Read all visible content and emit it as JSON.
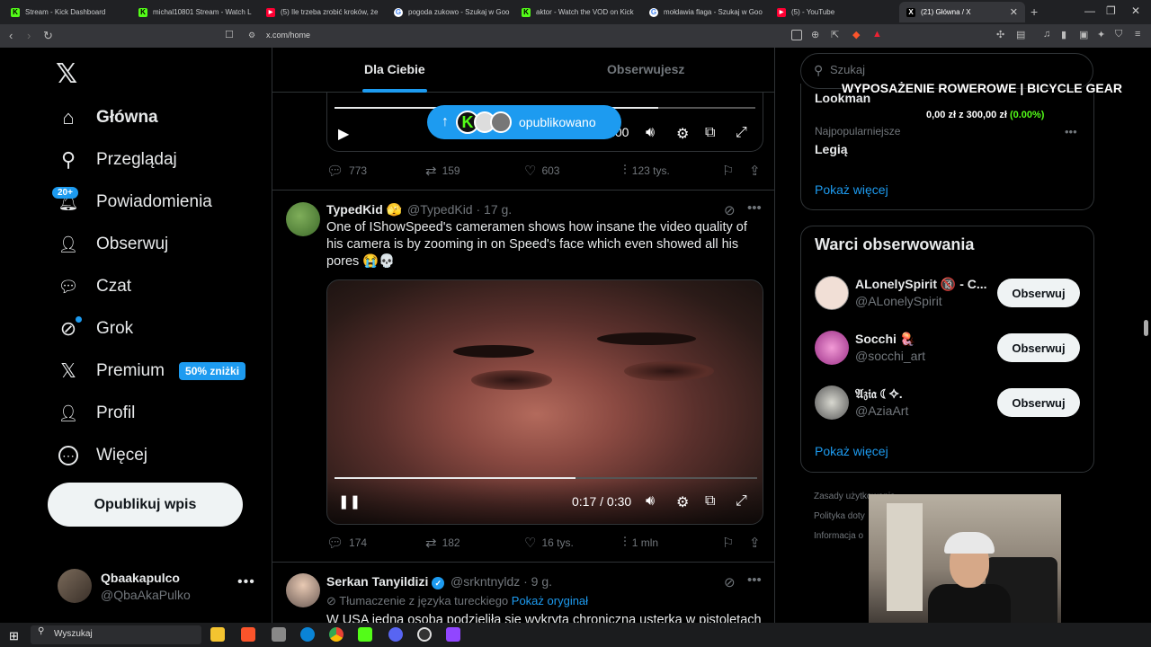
{
  "browser": {
    "tabs": [
      {
        "label": "Stream - Kick Dashboard",
        "fav_color": "#53fc18"
      },
      {
        "label": "michal10801 Stream - Watch L",
        "fav_color": "#53fc18"
      },
      {
        "label": "(5) Ile trzeba zrobić kroków, że",
        "fav_color": "#ff0033"
      },
      {
        "label": "pogoda zukowo - Szukaj w Goo",
        "fav_color": "#ffffff"
      },
      {
        "label": "aktor - Watch the VOD on Kick",
        "fav_color": "#53fc18"
      },
      {
        "label": "mołdawia flaga - Szukaj w Goo",
        "fav_color": "#ffffff"
      },
      {
        "label": "(5)                    - YouTube",
        "fav_color": "#ff0033"
      },
      {
        "label": "(21) Główna / X",
        "fav_color": "#ffffff"
      }
    ],
    "url": "x.com/home"
  },
  "sidebar": {
    "logo": "𝕏",
    "items": [
      {
        "label": "Główna",
        "icon": "home-icon",
        "glyph": "⌂"
      },
      {
        "label": "Przeglądaj",
        "icon": "search-icon",
        "glyph": "⚲"
      },
      {
        "label": "Powiadomienia",
        "icon": "bell-icon",
        "glyph": "🔔︎"
      },
      {
        "label": "Obserwuj",
        "icon": "add-person-icon",
        "glyph": "👤︎"
      },
      {
        "label": "Czat",
        "icon": "chat-icon",
        "glyph": "💬︎"
      },
      {
        "label": "Grok",
        "icon": "grok-icon",
        "glyph": "⊘"
      },
      {
        "label": "Premium",
        "icon": "x-premium-icon",
        "glyph": "𝕏"
      },
      {
        "label": "Profil",
        "icon": "profile-icon",
        "glyph": "👤︎"
      },
      {
        "label": "Więcej",
        "icon": "more-circle-icon",
        "glyph": "⋯"
      }
    ],
    "notif_badge": "20+",
    "premium_badge": "50% zniżki",
    "publish_label": "Opublikuj wpis",
    "user": {
      "name": "Qbaakapulco",
      "handle": "@QbaAkaPulko"
    }
  },
  "feed": {
    "tabs": [
      "Dla Ciebie",
      "Obserwujesz"
    ],
    "prev_time": ".00",
    "publish_pill": "opublikowano",
    "prev_actions": {
      "replies": "773",
      "reposts": "159",
      "likes": "603",
      "views": "123 tys."
    },
    "tweet1": {
      "name": "TypedKid",
      "emoji": "🫣",
      "handle": "@TypedKid",
      "time": "· 17 g.",
      "text_line1": "One of IShowSpeed's cameramen shows how insane the video quality of",
      "text_line2": "his camera is by zooming in on Speed's face which even showed all his",
      "text_line3": "pores 😭💀",
      "video_time": "0:17 / 0:30",
      "video_progress": 0.57,
      "actions": {
        "replies": "174",
        "reposts": "182",
        "likes": "16 tys.",
        "views": "1 mln"
      }
    },
    "tweet2": {
      "name": "Serkan Tanyildizi",
      "handle": "@srkntnyldz",
      "time": "· 9 g.",
      "translate_note": "Tłumaczenie z języka tureckiego",
      "translate_link": "Pokaż oryginał",
      "text": "W USA jedna osoba podzieliła się wykrytą chroniczną usterką w pistoletach"
    }
  },
  "right": {
    "search_placeholder": "Szukaj",
    "trends": [
      {
        "meta": "",
        "name": "Lookman"
      },
      {
        "meta": "Najpopularniejsze",
        "name": "Legią"
      }
    ],
    "show_more": "Pokaż więcej",
    "follow_title": "Warci obserwowania",
    "follow": [
      {
        "name": "ALonelySpirit 🔞 - C...",
        "handle": "@ALonelySpirit",
        "color": "#f1dfd6"
      },
      {
        "name": "Socchi 🪼",
        "handle": "@socchi_art",
        "color": "#c54aa8"
      },
      {
        "name": "𝔄𝔷𝔦𝔞 ☾✧.",
        "handle": "@AziaArt",
        "color": "#8d8f8a"
      }
    ],
    "follow_btn": "Obserwuj",
    "footer": [
      "Zasady użytkowania",
      "Polityka doty",
      "Informacja o"
    ]
  },
  "overlay": {
    "title": "WYPOSAŻENIE ROWEROWE | BICYCLE GEAR",
    "amount": "0,00 zł z 300,00 zł",
    "pct": "(0.00%)"
  },
  "taskbar": {
    "search": "Wyszukaj"
  }
}
